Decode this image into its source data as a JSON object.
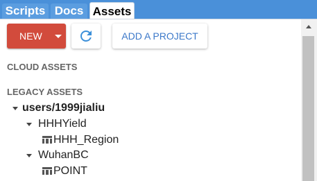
{
  "tabs": [
    {
      "label": "Scripts"
    },
    {
      "label": "Docs"
    },
    {
      "label": "Assets",
      "active": true
    }
  ],
  "toolbar": {
    "new_label": "NEW",
    "refresh_icon": "refresh-icon",
    "add_project_label": "ADD A PROJECT"
  },
  "sections": {
    "cloud": "CLOUD ASSETS",
    "legacy": "LEGACY ASSETS"
  },
  "tree": {
    "root": "users/1999jialiu",
    "folders": [
      {
        "name": "HHHYield",
        "tables": [
          "HHH_Region"
        ]
      },
      {
        "name": "WuhanBC",
        "tables": [
          "POINT"
        ]
      }
    ]
  },
  "colors": {
    "accent_blue": "#4a90d9",
    "new_button_red": "#d24b3c",
    "link_blue": "#3b78c9"
  }
}
